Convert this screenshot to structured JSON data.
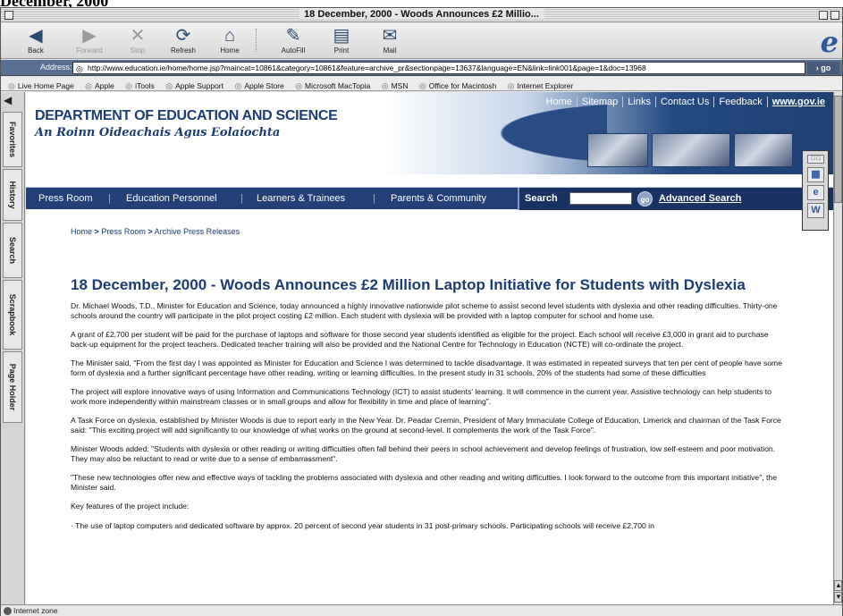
{
  "page_heading": "December, 2000",
  "window": {
    "title": "18 December, 2000 - Woods Announces £2 Millio..."
  },
  "toolbar": {
    "buttons": [
      {
        "label": "Back",
        "icon": "back-arrow-icon"
      },
      {
        "label": "Forward",
        "icon": "forward-arrow-icon"
      },
      {
        "label": "Stop",
        "icon": "stop-icon"
      },
      {
        "label": "Refresh",
        "icon": "refresh-icon"
      },
      {
        "label": "Home",
        "icon": "home-icon"
      },
      {
        "label": "AutoFill",
        "icon": "autofill-icon"
      },
      {
        "label": "Print",
        "icon": "print-icon"
      },
      {
        "label": "Mail",
        "icon": "mail-icon"
      }
    ]
  },
  "address": {
    "label": "Address:",
    "url": "http://www.education.ie/home/home.jsp?maincat=10861&category=10861&feature=archive_pr&sectionpage=13637&language=EN&link=link001&page=1&doc=13968",
    "go": "go"
  },
  "favorites": [
    "Live Home Page",
    "Apple",
    "iTools",
    "Apple Support",
    "Apple Store",
    "Microsoft MacTopia",
    "MSN",
    "Office for Macintosh",
    "Internet Explorer"
  ],
  "sidetabs": [
    "Favorites",
    "History",
    "Search",
    "Scrapbook",
    "Page Holder"
  ],
  "site": {
    "dept_name": "DEPARTMENT OF EDUCATION AND SCIENCE",
    "dept_name_irish": "An Roinn Oideachais Agus Eolaíochta",
    "top_links": [
      "Home",
      "Sitemap",
      "Links",
      "Contact Us",
      "Feedback",
      "www.gov.ie"
    ],
    "nav": [
      "Press Room",
      "Education Personnel",
      "Learners & Trainees",
      "Parents & Community"
    ],
    "search_label": "Search",
    "search_go": "go",
    "advanced_search": "Advanced Search"
  },
  "breadcrumb": {
    "home": "Home",
    "press_room": "Press Room",
    "archive": "Archive Press Releases"
  },
  "article": {
    "title": "18 December, 2000 - Woods Announces £2 Million Laptop Initiative for Students with Dyslexia",
    "paragraphs": [
      "Dr. Michael Woods, T.D., Minister for Education and Science, today announced a highly innovative nationwide pilot scheme to assist second level students with dyslexia and other reading difficulties. Thirty-one schools around the country will participate in the pilot project costing £2 million. Each student with dyslexia will be provided with a laptop computer for school and home use.",
      "A grant of £2,700 per student will be paid for the purchase of laptops and software for those second year students identified as eligible for the project. Each school will receive £3,000 in grant aid to purchase back-up equipment for the project teachers. Dedicated teacher training will also be provided and the National Centre for Technology in Education (NCTE) will co-ordinate the project.",
      "The Minister said, \"From the first day I was appointed as Minister for Education and Science I was determined to tackle disadvantage. It was estimated in repeated surveys that ten per cent of people have some form of dyslexia and a further significant percentage have other reading, writing or learning difficulties. In the present study in 31 schools, 20% of the students had some of these difficulties",
      "The project will explore innovative ways of using Information and Communications Technology (ICT) to assist students' learning. It will commence in the current year. Assistive technology can help students to work more independently within mainstream classes or in small groups and allow for flexibility in time and place of learning\".",
      "A Task Force on dyslexia, established by Minister Woods is due to report early in the New Year. Dr. Peadar Cremin, President of Mary Immaculate College of Education, Limerick and chairman of the Task Force said: \"This exciting project will add significantly to our knowledge of what works on the ground at second-level. It complements the work of the Task Force\".",
      "Minister Woods added: \"Students with dyslexia or other reading or writing difficulties often fall behind their peers in school achievement and develop feelings of frustration, low self-esteem and poor motivation. They may also be reluctant to read or write due to a sense of embarrassment\".",
      "\"These new technologies offer new and effective ways of tackling the problems associated with dyslexia and other reading and writing difficulties. I look forward to the outcome from this important initiative\", the Minister said.",
      "Key features of the project include:",
      "· The use of laptop computers and dedicated software by approx. 20 percent of second year students in 31 post-primary schools. Participating schools will receive £2,700 in"
    ]
  },
  "status": {
    "zone": "Internet zone"
  }
}
